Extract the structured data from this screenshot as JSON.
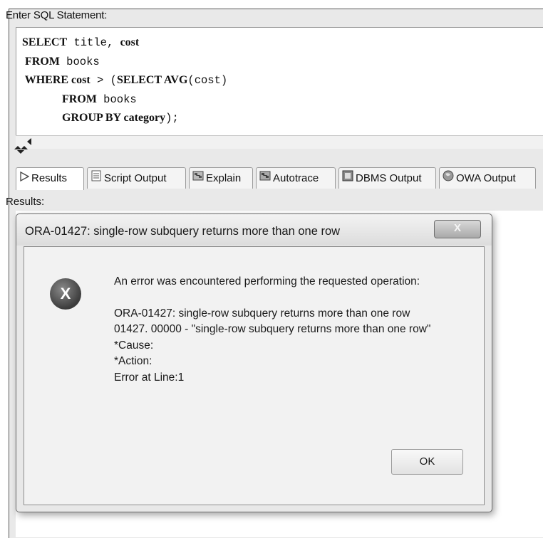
{
  "worksheet": {
    "enter_label": "Enter SQL Statement:",
    "sql_lines": [
      {
        "kw1": "SELECT",
        "t1": " title, ",
        "kw2": "cost",
        "t2": ""
      },
      {
        "kw1": " FROM",
        "t1": " books",
        "kw2": "",
        "t2": ""
      },
      {
        "kw1": " WHERE cost",
        "t1": " > (",
        "kw2": "SELECT AVG",
        "t2": "(cost)"
      },
      {
        "kw1": "              FROM",
        "t1": " books",
        "kw2": "",
        "t2": ""
      },
      {
        "kw1": "              GROUP BY category",
        "t1": ");",
        "kw2": "",
        "t2": ""
      }
    ],
    "results_label": "Results:"
  },
  "tabs": [
    {
      "label": "Results",
      "icon": "play-icon"
    },
    {
      "label": "Script Output",
      "icon": "script-icon"
    },
    {
      "label": "Explain",
      "icon": "explain-icon"
    },
    {
      "label": "Autotrace",
      "icon": "autotrace-icon"
    },
    {
      "label": "DBMS Output",
      "icon": "dbms-icon"
    },
    {
      "label": "OWA Output",
      "icon": "globe-icon"
    }
  ],
  "dialog": {
    "title": "ORA-01427: single-row subquery returns more than one row",
    "close_label": "X",
    "icon_label": "X",
    "message_intro": "An error was encountered performing the requested operation:",
    "error_line": "ORA-01427: single-row subquery returns more than one row",
    "code_line": "01427. 00000 -  \"single-row subquery returns more than one row\"",
    "cause": "*Cause:",
    "action": "*Action:",
    "error_at": "Error at Line:1",
    "ok_label": "OK"
  }
}
